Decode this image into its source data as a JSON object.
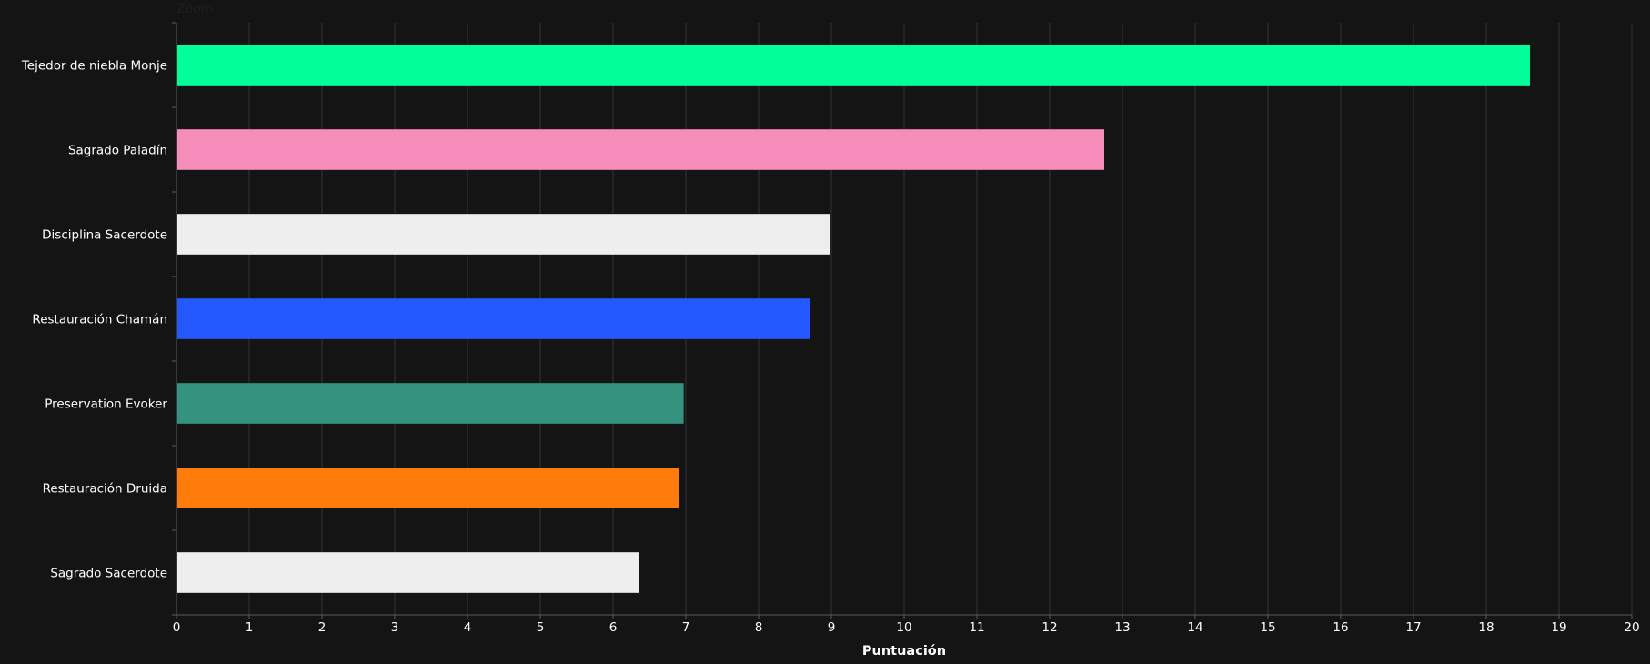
{
  "zoom_label": "Zoom",
  "chart_data": {
    "type": "bar",
    "orientation": "horizontal",
    "title": "",
    "xlabel": "Puntuación",
    "ylabel": "",
    "xlim": [
      0,
      20
    ],
    "x_ticks": [
      0,
      1,
      2,
      3,
      4,
      5,
      6,
      7,
      8,
      9,
      10,
      11,
      12,
      13,
      14,
      15,
      16,
      17,
      18,
      19,
      20
    ],
    "grid": true,
    "legend": false,
    "categories": [
      "Tejedor de niebla Monje",
      "Sagrado Paladín",
      "Disciplina Sacerdote",
      "Restauración Chamán",
      "Preservation Evoker",
      "Restauración Druida",
      "Sagrado Sacerdote"
    ],
    "values": [
      18.6,
      12.75,
      8.98,
      8.7,
      6.97,
      6.91,
      6.36
    ],
    "colors": [
      "#00ff98",
      "#f58cba",
      "#eeeeee",
      "#2459ff",
      "#33937f",
      "#ff7c0a",
      "#eeeeee"
    ]
  },
  "colors": {
    "background": "#141414",
    "grid": "#333333",
    "text": "#ffffff"
  }
}
